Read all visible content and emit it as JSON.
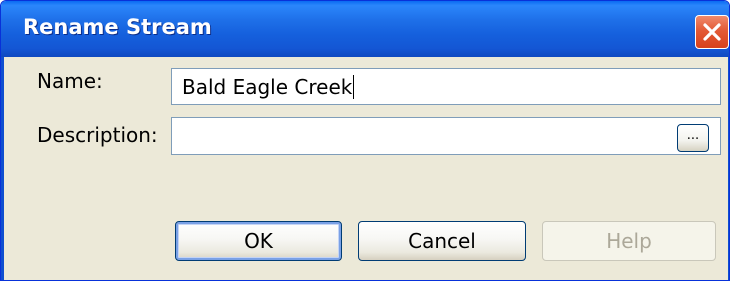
{
  "window": {
    "title": "Rename Stream",
    "close_icon": "close-icon"
  },
  "form": {
    "name_label": "Name:",
    "name_value": "Bald Eagle Creek",
    "description_label": "Description:",
    "description_value": "",
    "ellipsis_label": "..."
  },
  "buttons": {
    "ok_label": "OK",
    "cancel_label": "Cancel",
    "help_label": "Help",
    "help_enabled": false
  },
  "colors": {
    "titlebar": "#1560dd",
    "frame": "#0f4fd0",
    "face": "#ece9d8",
    "close": "#e35a36",
    "disabled_text": "#aca899"
  }
}
